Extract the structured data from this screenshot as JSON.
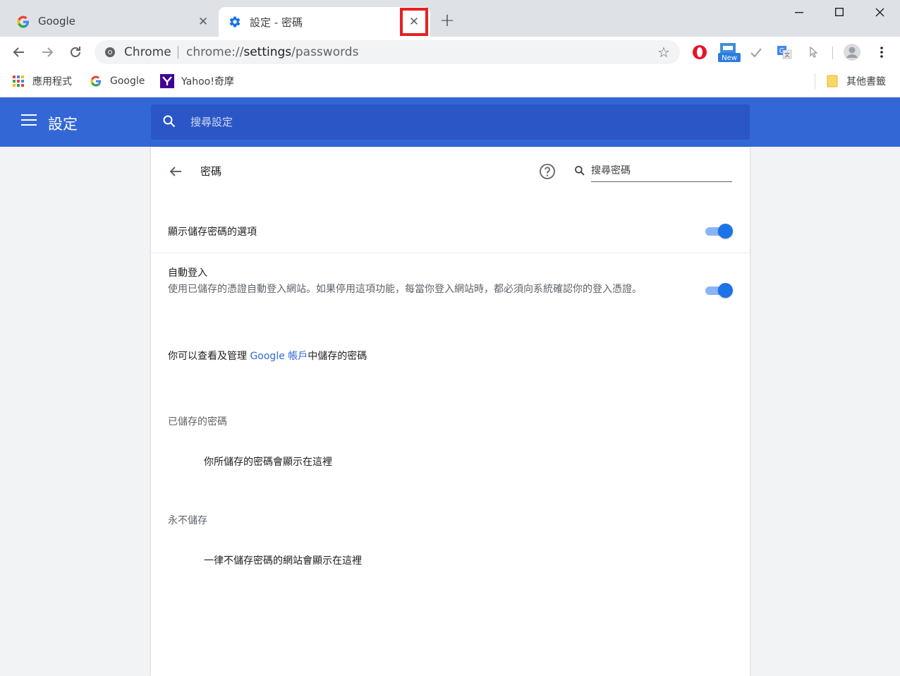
{
  "tabs": [
    {
      "title": "Google",
      "close": "✕"
    },
    {
      "title": "設定 - 密碼",
      "close": "✕"
    }
  ],
  "new_tab": "+",
  "window": {
    "minimize": "—",
    "maximize": "☐",
    "close": "✕"
  },
  "omnibox": {
    "site": "Chrome",
    "url_scheme": "chrome://",
    "url_host": "settings",
    "url_path": "/passwords"
  },
  "bookmarks": [
    {
      "label": "應用程式",
      "icon": "apps-grid-icon"
    },
    {
      "label": "Google",
      "icon": "google-g-icon"
    },
    {
      "label": "Yahoo!奇摩",
      "icon": "yahoo-icon"
    }
  ],
  "other_bookmarks": "其他書籤",
  "extensions": {
    "new_badge": "New"
  },
  "header": {
    "title": "設定",
    "search_placeholder": "搜尋設定"
  },
  "passwords": {
    "title": "密碼",
    "search_placeholder": "搜尋密碼",
    "offer_to_save": {
      "label": "顯示儲存密碼的選項",
      "enabled": true
    },
    "auto_signin": {
      "label": "自動登入",
      "description": "使用已儲存的憑證自動登入網站。如果停用這項功能，每當你登入網站時，都必須向系統確認你的登入憑證。",
      "enabled": true
    },
    "manage_prefix": "你可以查看及管理 ",
    "manage_link": "Google 帳戶",
    "manage_suffix": "中儲存的密碼",
    "saved_heading": "已儲存的密碼",
    "saved_empty": "你所儲存的密碼會顯示在這裡",
    "never_heading": "永不儲存",
    "never_empty": "一律不儲存密碼的網站會顯示在這裡"
  },
  "colors": {
    "header_blue": "#3367d6",
    "search_blue": "#2a56c6",
    "toggle_on": "#1a73e8",
    "highlight": "#e52222"
  }
}
